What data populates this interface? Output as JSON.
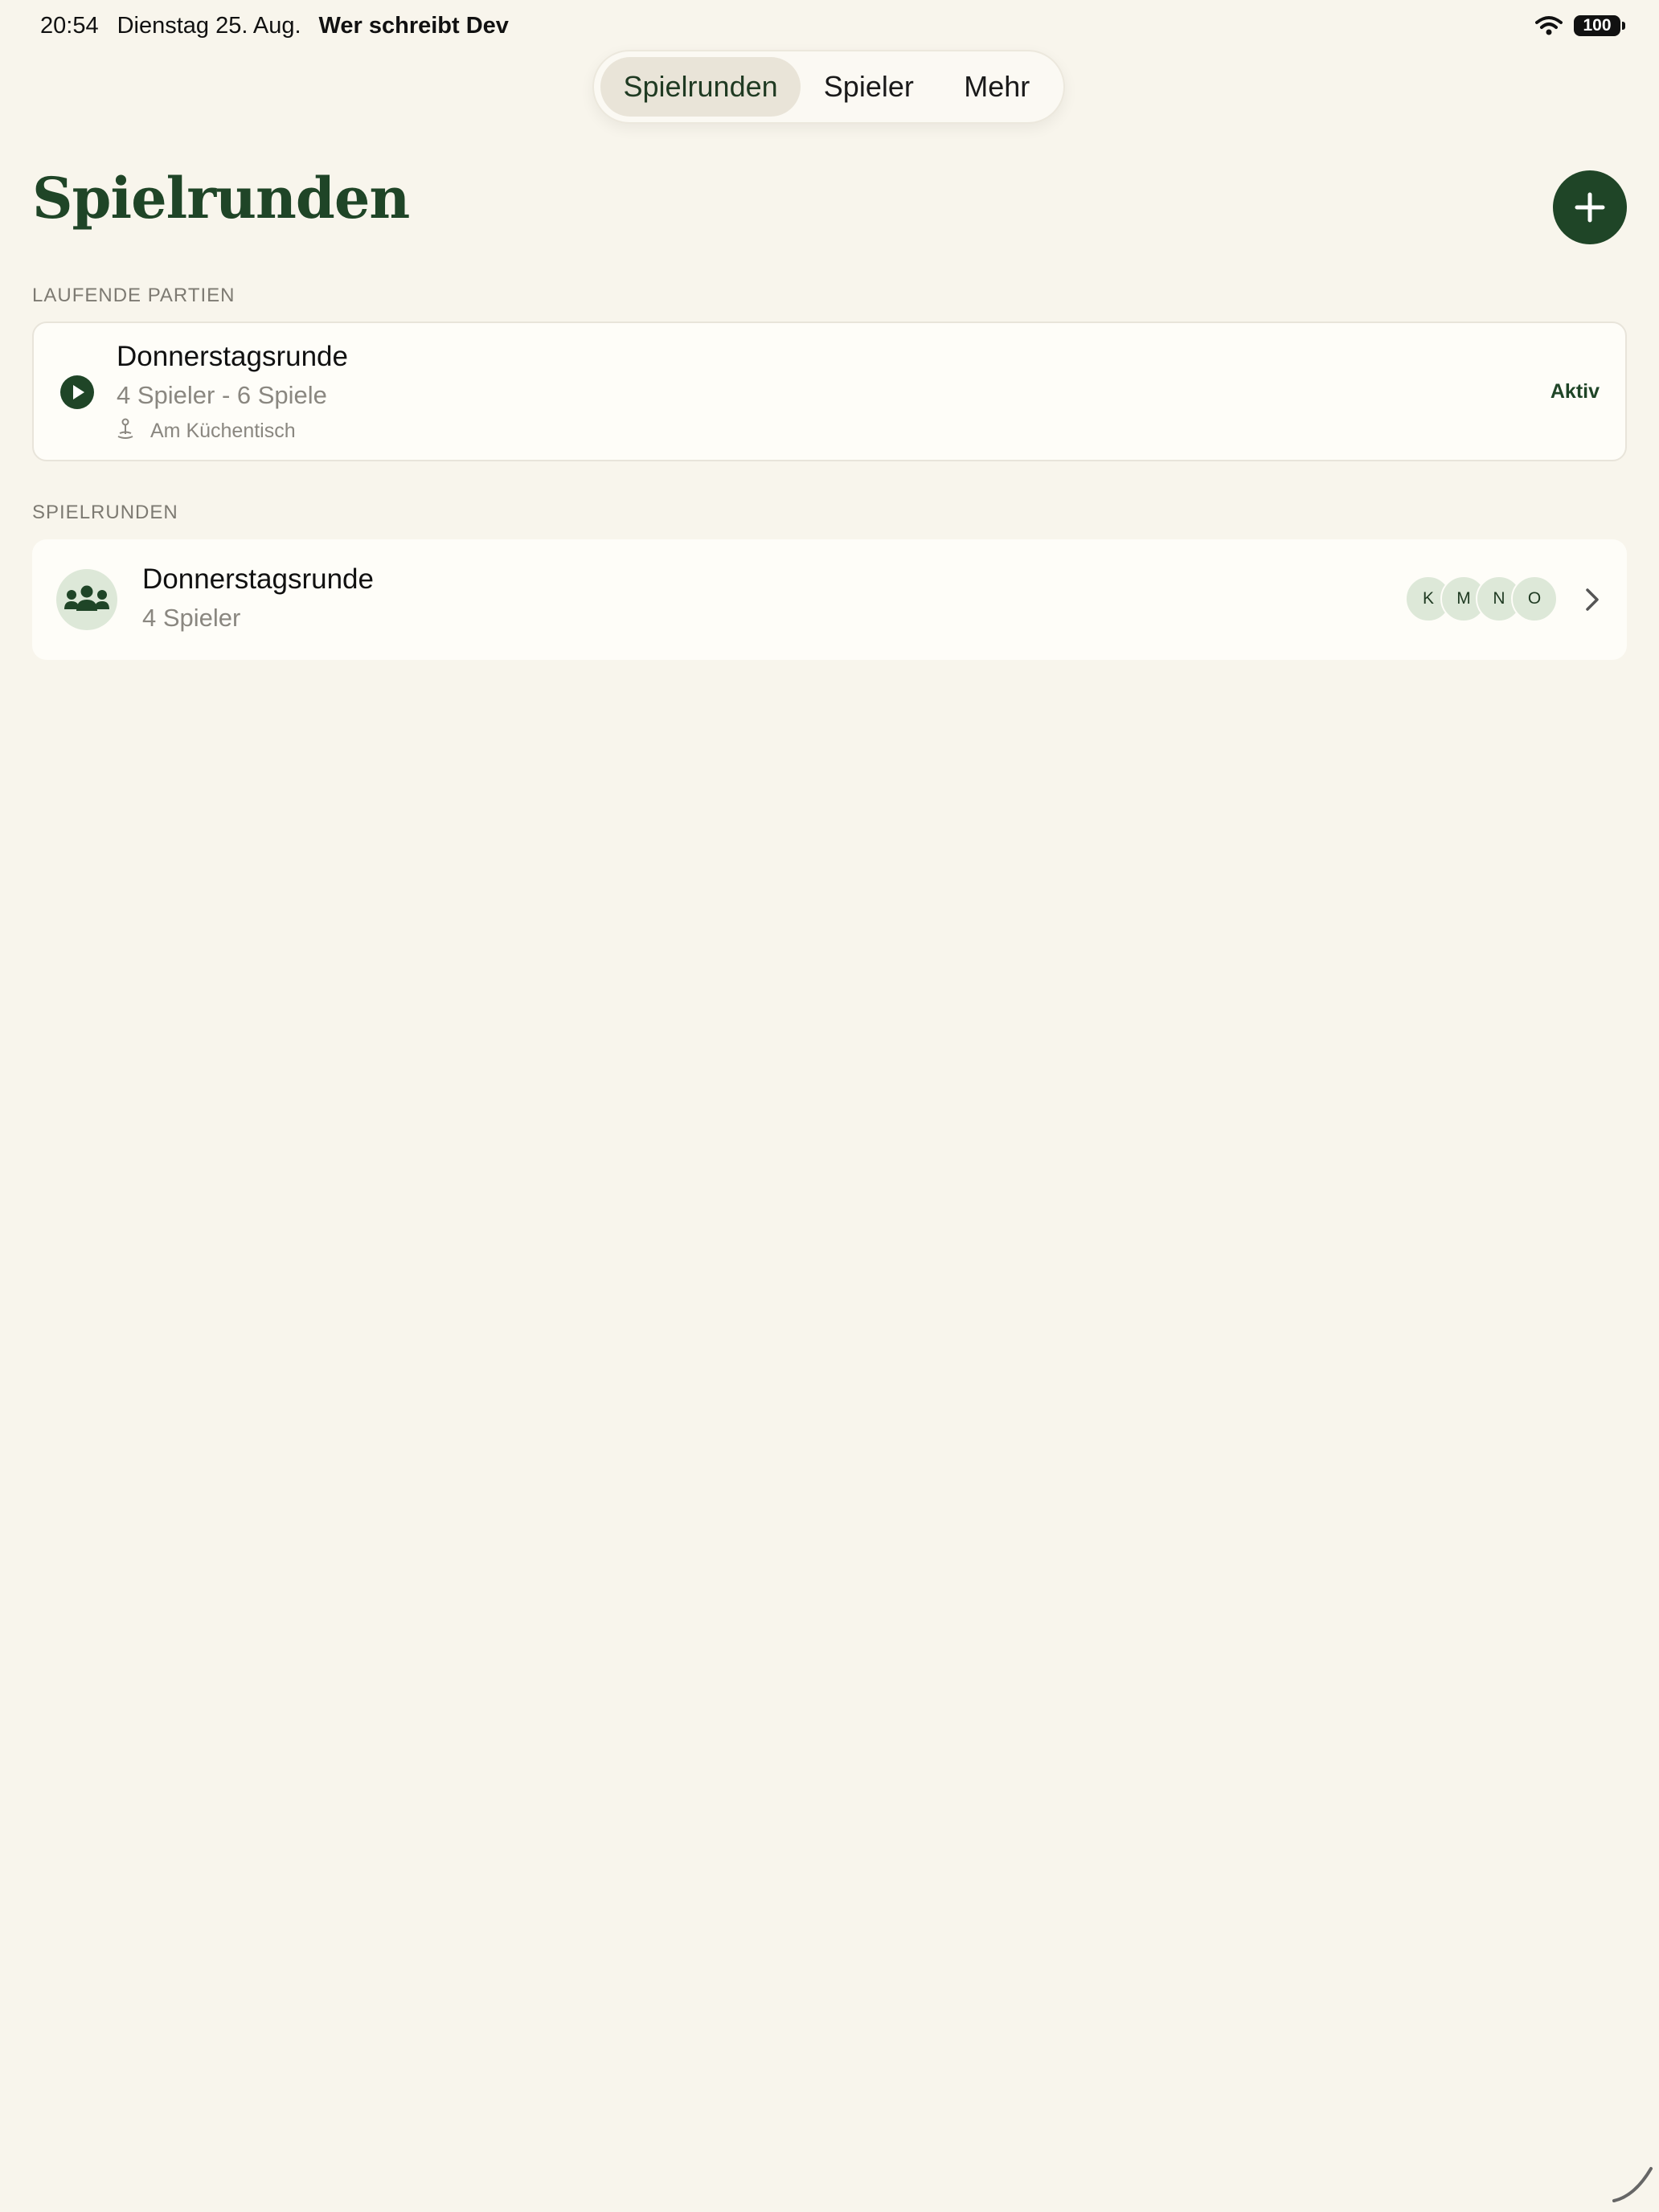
{
  "status_bar": {
    "time": "20:54",
    "date": "Dienstag 25. Aug.",
    "app_name": "Wer schreibt Dev",
    "battery": "100"
  },
  "tabs": [
    {
      "label": "Spielrunden",
      "active": true
    },
    {
      "label": "Spieler",
      "active": false
    },
    {
      "label": "Mehr",
      "active": false
    }
  ],
  "page": {
    "title": "Spielrunden"
  },
  "running": {
    "section_header": "LAUFENDE PARTIEN",
    "items": [
      {
        "title": "Donnerstagsrunde",
        "meta": "4 Spieler - 6 Spiele",
        "location": "Am Küchentisch",
        "status": "Aktiv"
      }
    ]
  },
  "groups": {
    "section_header": "SPIELRUNDEN",
    "items": [
      {
        "title": "Donnerstagsrunde",
        "subtitle": "4 Spieler",
        "players": [
          "K",
          "M",
          "N",
          "O"
        ]
      }
    ]
  },
  "colors": {
    "background": "#F8F5EC",
    "accent": "#1F4527",
    "card": "#FEFDF8",
    "avatar": "#DDE8D8"
  }
}
